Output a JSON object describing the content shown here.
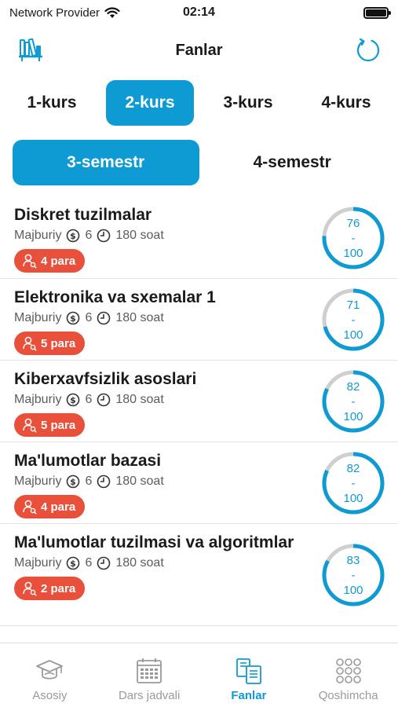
{
  "status": {
    "carrier": "Network Provider",
    "time": "02:14"
  },
  "header": {
    "title": "Fanlar",
    "left_icon": "bookshelf-icon",
    "right_icon": "refresh-icon"
  },
  "colors": {
    "accent": "#0e9ad3",
    "badge": "#e8503c",
    "ring_track": "#cfcfcf"
  },
  "courses": [
    {
      "label": "1-kurs",
      "active": false
    },
    {
      "label": "2-kurs",
      "active": true
    },
    {
      "label": "3-kurs",
      "active": false
    },
    {
      "label": "4-kurs",
      "active": false
    }
  ],
  "semesters": [
    {
      "label": "3-semestr",
      "active": true
    },
    {
      "label": "4-semestr",
      "active": false
    }
  ],
  "subjects": [
    {
      "name": "Diskret tuzilmalar",
      "type": "Majburiy",
      "credits": "6",
      "hours": "180 soat",
      "badge": "4 para",
      "score": 76,
      "score_sep": "-",
      "max": 100
    },
    {
      "name": "Elektronika va sxemalar 1",
      "type": "Majburiy",
      "credits": "6",
      "hours": "180 soat",
      "badge": "5 para",
      "score": 71,
      "score_sep": "-",
      "max": 100
    },
    {
      "name": "Kiberxavfsizlik asoslari",
      "type": "Majburiy",
      "credits": "6",
      "hours": "180 soat",
      "badge": "5 para",
      "score": 82,
      "score_sep": "-",
      "max": 100
    },
    {
      "name": "Ma'lumotlar bazasi",
      "type": "Majburiy",
      "credits": "6",
      "hours": "180 soat",
      "badge": "4 para",
      "score": 82,
      "score_sep": "-",
      "max": 100
    },
    {
      "name": "Ma'lumotlar tuzilmasi va algoritmlar",
      "type": "Majburiy",
      "credits": "6",
      "hours": "180 soat",
      "badge": "2 para",
      "score": 83,
      "score_sep": "-",
      "max": 100
    }
  ],
  "tabbar": [
    {
      "label": "Asosiy",
      "icon": "graduation-cap-icon",
      "active": false
    },
    {
      "label": "Dars jadvali",
      "icon": "calendar-icon",
      "active": false
    },
    {
      "label": "Fanlar",
      "icon": "books-icon",
      "active": true
    },
    {
      "label": "Qoshimcha",
      "icon": "grid-dots-icon",
      "active": false
    }
  ]
}
